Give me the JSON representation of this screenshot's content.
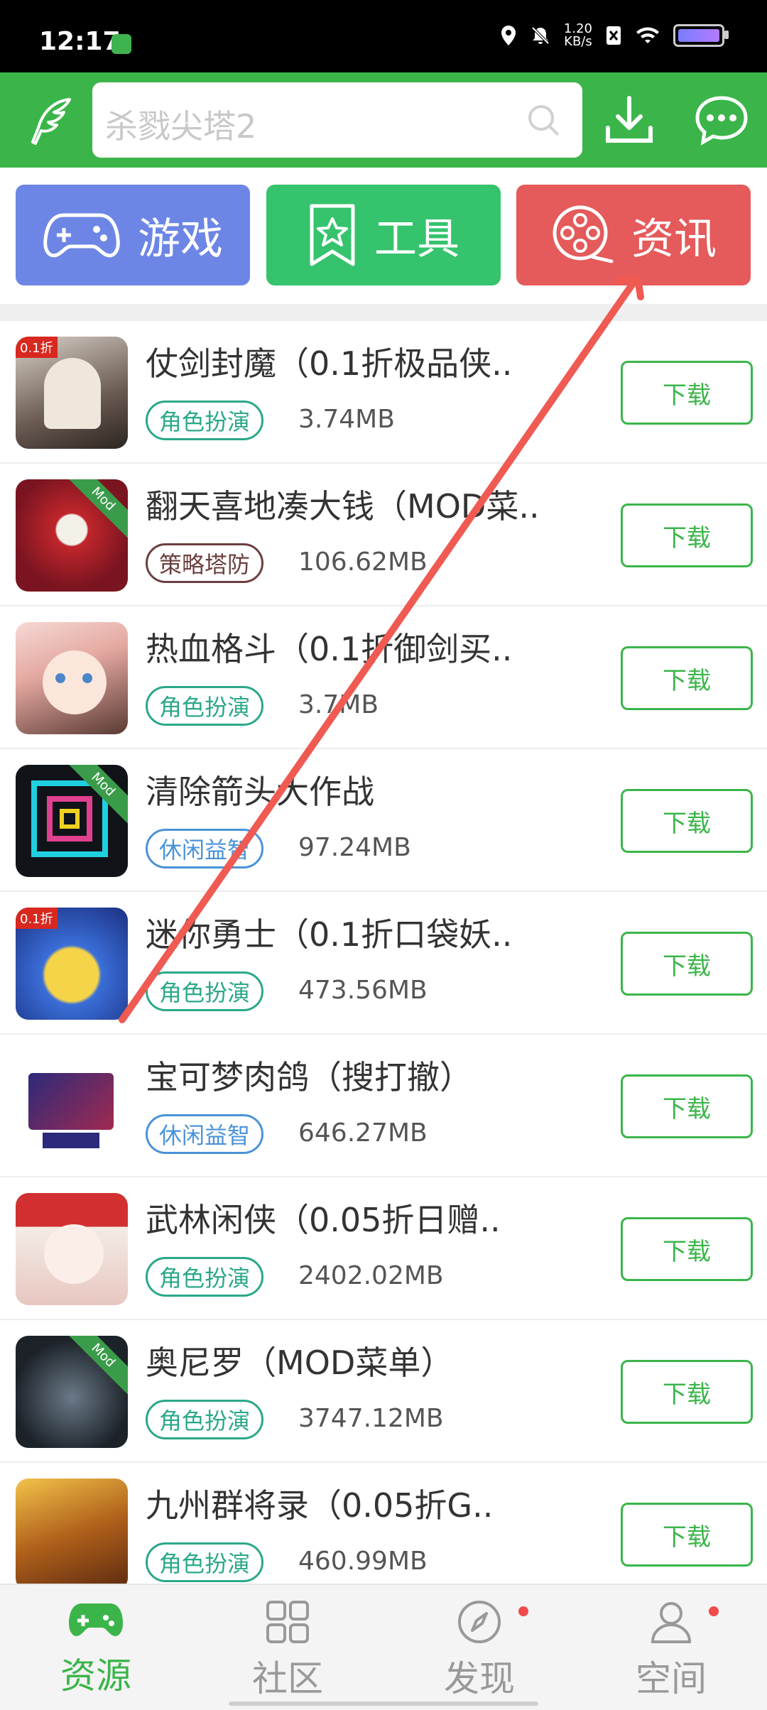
{
  "status_bar": {
    "time": "12:17",
    "speed_value": "1.20",
    "speed_unit": "KB/s"
  },
  "search": {
    "placeholder": "杀戮尖塔2"
  },
  "categories": [
    {
      "label": "游戏",
      "color": "#6d86e6"
    },
    {
      "label": "工具",
      "color": "#35c36d"
    },
    {
      "label": "资讯",
      "color": "#e55a5a"
    }
  ],
  "download_label": "下载",
  "apps": [
    {
      "name": "仗剑封魔（0.1折极品侠..",
      "tag": "角色扮演",
      "size": "3.74MB"
    },
    {
      "name": "翻天喜地凑大钱（MOD菜..",
      "tag": "策略塔防",
      "size": "106.62MB"
    },
    {
      "name": "热血格斗（0.1折御剑买..",
      "tag": "角色扮演",
      "size": "3.7MB"
    },
    {
      "name": "清除箭头大作战",
      "tag": "休闲益智",
      "size": "97.24MB"
    },
    {
      "name": "迷你勇士（0.1折口袋妖..",
      "tag": "角色扮演",
      "size": "473.56MB"
    },
    {
      "name": "宝可梦肉鸽（搜打撤）",
      "tag": "休闲益智",
      "size": "646.27MB"
    },
    {
      "name": "武林闲侠（0.05折日赠..",
      "tag": "角色扮演",
      "size": "2402.02MB"
    },
    {
      "name": "奥尼罗（MOD菜单）",
      "tag": "角色扮演",
      "size": "3747.12MB"
    },
    {
      "name": "九州群将录（0.05折G..",
      "tag": "角色扮演",
      "size": "460.99MB"
    }
  ],
  "nav": [
    {
      "label": "资源",
      "active": true
    },
    {
      "label": "社区"
    },
    {
      "label": "发现"
    },
    {
      "label": "空间"
    }
  ]
}
